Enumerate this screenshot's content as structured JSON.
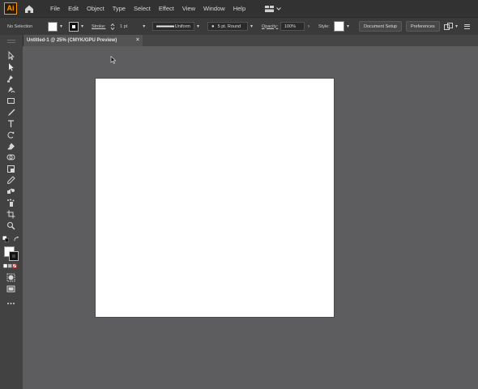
{
  "app": {
    "logo_text": "Ai"
  },
  "menu": {
    "items": [
      "File",
      "Edit",
      "Object",
      "Type",
      "Select",
      "Effect",
      "View",
      "Window",
      "Help"
    ]
  },
  "control_bar": {
    "selection_label": "No Selection",
    "stroke_label": "Stroke:",
    "stroke_weight": "1 pt",
    "stroke_profile": "Uniform",
    "brush": "5 pt. Round",
    "opacity_label": "Opacity:",
    "opacity_value": "100%",
    "style_label": "Style:",
    "document_setup": "Document Setup",
    "preferences": "Preferences"
  },
  "document": {
    "tab_title": "Untitled-1 @ 25% (CMYK/GPU Preview)",
    "close_glyph": "×"
  },
  "colors": {
    "menubar": "#323232",
    "controlbar": "#3a3a3a",
    "panel": "#424242",
    "canvas": "#5d5c5e",
    "artboard": "#ffffff",
    "logo_accent": "#ff9a00"
  },
  "tools": [
    "selection-tool",
    "direct-selection-tool",
    "pen-tool",
    "curvature-tool",
    "rectangle-tool",
    "paintbrush-tool",
    "type-tool",
    "rotate-tool",
    "eraser-tool",
    "shape-builder-tool",
    "free-transform-tool",
    "eyedropper-tool",
    "blend-tool",
    "symbol-sprayer-tool",
    "artboard-tool",
    "zoom-tool",
    "default-colors",
    "swap-colors",
    "fill-stroke",
    "color-mode-buttons",
    "draw-mode-buttons",
    "screen-mode-button",
    "more-tools"
  ]
}
